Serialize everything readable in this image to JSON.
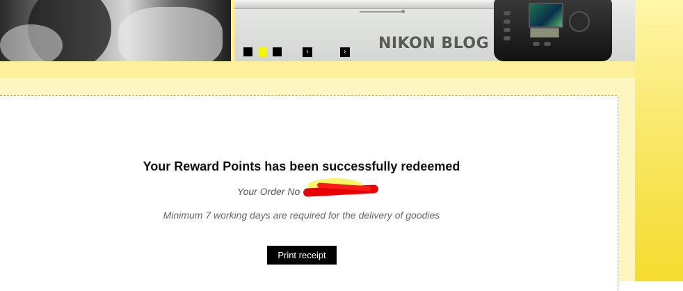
{
  "banner": {
    "slide_title": "NIKON BLOG",
    "slide_indicators": [
      {
        "active": false
      },
      {
        "active": true
      },
      {
        "active": false
      }
    ],
    "prev_arrow": "‹",
    "next_arrow": "›"
  },
  "confirmation": {
    "headline": "Your Reward Points has been successfully redeemed",
    "order_label": "Your Order No",
    "delivery_note": "Minimum 7 working days are required for the delivery of goodies",
    "print_label": "Print receipt"
  },
  "colors": {
    "accent_yellow": "#f5f900",
    "page_yellow": "#fdf09a",
    "button_bg": "#000000"
  }
}
